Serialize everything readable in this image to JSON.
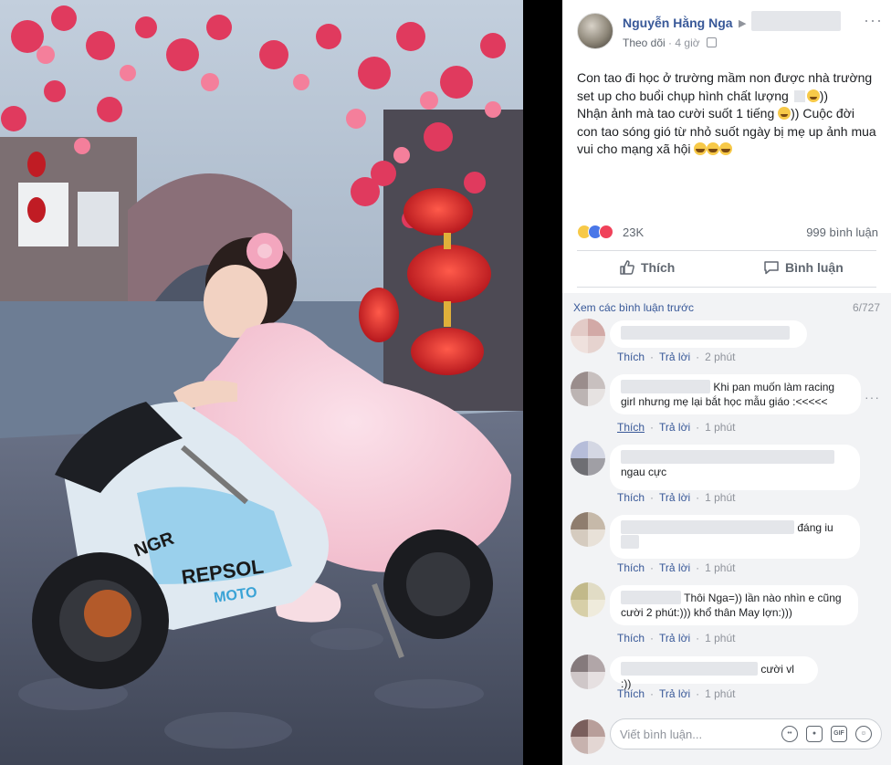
{
  "post": {
    "author": "Nguyễn Hằng Nga",
    "follow": "Theo dõi",
    "time": "4 giờ",
    "text_line1": "Con tao đi học ở trường mầm non được nhà trường set up cho buổi chụp hình chất lượng",
    "text_line1_end": "))",
    "text_line2": "Nhận ảnh mà tao cười suốt 1 tiếng",
    "text_line2_end": ")) Cuộc đời con tao sóng gió từ nhỏ suốt ngày bị mẹ up ảnh mua vui cho mạng xã hội",
    "reaction_count": "23K",
    "comment_count": "999 bình luận",
    "like_button": "Thích",
    "comment_button": "Bình luận"
  },
  "comments": {
    "prev_link": "Xem các bình luận trước",
    "page_count": "6/727",
    "like": "Thích",
    "reply": "Trả lời",
    "items": [
      {
        "text": "",
        "time": "2 phút"
      },
      {
        "text_a": "Khi pan muốn làm racing",
        "text_b": "girl nhưng mẹ lại bắt học mẫu giáo :<<<<<",
        "time": "1 phút"
      },
      {
        "text": "ngau cực",
        "time": "1 phút"
      },
      {
        "text": "đáng iu",
        "time": "1 phút"
      },
      {
        "text_a": "Thôi Nga=)) lần nào nhìn e cũng",
        "text_b": "cười 2 phút:))) khổ thân May lợn:)))",
        "time": "1 phút"
      },
      {
        "text": "cười vl :))",
        "time": "1 phút"
      }
    ],
    "write_placeholder": "Viết bình luận...",
    "gif_label": "GIF"
  },
  "colors": {
    "link": "#385898",
    "muted": "#90949c",
    "comments_bg": "#f2f3f5"
  }
}
